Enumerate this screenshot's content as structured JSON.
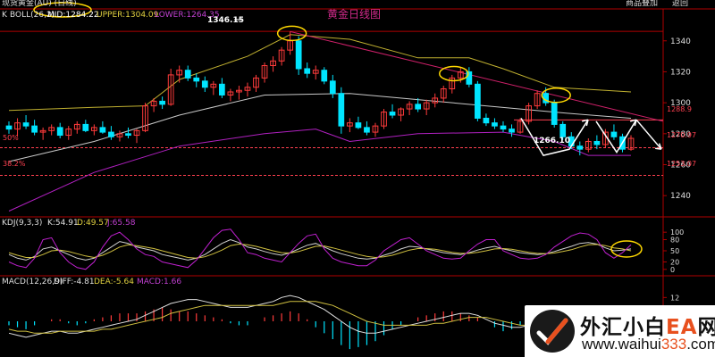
{
  "window": {
    "title": "现货黄金(AU) (日线)",
    "top_right": [
      "商品叠加",
      "返回"
    ]
  },
  "main_indicator": {
    "name": "K",
    "boll_label": "BOLL(26,2)",
    "mid_label": "MID:1284.22",
    "upper_label": "UPPER:1304.09",
    "lower_label": "LOWER:1264.35",
    "chart_title": "黄金日线图"
  },
  "kdj_header": {
    "name": "KDJ(9,3,3)",
    "k": "K:54.91",
    "d": "D:49.57",
    "j": "J:65.58"
  },
  "macd_header": {
    "name": "MACD(12,26,9)",
    "diff": "DIFF:-4.81",
    "dea": "DEA:-5.64",
    "macd": "MACD:1.66"
  },
  "annotations": {
    "high_label": "1346.15",
    "low_label": "1266.10",
    "pct50": "50%",
    "pct382": "38.2%",
    "level_upper": "1288.9",
    "level_mid": "1270.97",
    "level_lower": "1253.07"
  },
  "watermark": {
    "brand_a": "外汇小白",
    "brand_b": "EA",
    "brand_c": "网",
    "url_a": "www.waihui",
    "url_b": "333",
    "url_c": ".com"
  },
  "colors": {
    "up": "#ff3b3b",
    "down": "#00e5ff",
    "mid": "#c8c8c8",
    "upper": "#c0b030",
    "lower": "#b020c0",
    "trend": "#d0206a",
    "level": "#ff4050",
    "arrows": "#ffffff",
    "circle": "#ffd800",
    "kdj_k": "#d0d0d0",
    "kdj_d": "#d0c040",
    "kdj_j": "#c020d0"
  },
  "chart_data": [
    {
      "type": "candlestick",
      "title": "黄金日线图",
      "ylim": [
        1228,
        1356
      ],
      "yticks": [
        1240,
        1260,
        1280,
        1300,
        1320,
        1340
      ],
      "candles": [
        [
          1285,
          1288,
          1280,
          1283
        ],
        [
          1283,
          1290,
          1278,
          1287
        ],
        [
          1287,
          1292,
          1283,
          1285
        ],
        [
          1285,
          1289,
          1279,
          1281
        ],
        [
          1281,
          1284,
          1276,
          1282
        ],
        [
          1282,
          1286,
          1279,
          1284
        ],
        [
          1284,
          1287,
          1277,
          1279
        ],
        [
          1279,
          1285,
          1276,
          1283
        ],
        [
          1283,
          1288,
          1280,
          1286
        ],
        [
          1286,
          1289,
          1281,
          1282
        ],
        [
          1282,
          1286,
          1279,
          1284
        ],
        [
          1284,
          1288,
          1280,
          1281
        ],
        [
          1281,
          1285,
          1276,
          1278
        ],
        [
          1278,
          1282,
          1275,
          1280
        ],
        [
          1280,
          1284,
          1277,
          1279
        ],
        [
          1279,
          1283,
          1274,
          1282
        ],
        [
          1282,
          1300,
          1281,
          1298
        ],
        [
          1298,
          1303,
          1294,
          1301
        ],
        [
          1301,
          1304,
          1296,
          1299
        ],
        [
          1299,
          1322,
          1298,
          1318
        ],
        [
          1318,
          1324,
          1313,
          1321
        ],
        [
          1321,
          1324,
          1314,
          1316
        ],
        [
          1316,
          1319,
          1310,
          1314
        ],
        [
          1314,
          1317,
          1307,
          1310
        ],
        [
          1310,
          1314,
          1305,
          1312
        ],
        [
          1312,
          1316,
          1303,
          1305
        ],
        [
          1305,
          1309,
          1301,
          1307
        ],
        [
          1307,
          1311,
          1302,
          1308
        ],
        [
          1308,
          1313,
          1304,
          1310
        ],
        [
          1310,
          1318,
          1307,
          1316
        ],
        [
          1316,
          1326,
          1313,
          1324
        ],
        [
          1324,
          1330,
          1320,
          1327
        ],
        [
          1327,
          1336,
          1324,
          1334
        ],
        [
          1334,
          1346,
          1331,
          1340
        ],
        [
          1340,
          1343,
          1318,
          1322
        ],
        [
          1322,
          1326,
          1316,
          1319
        ],
        [
          1319,
          1324,
          1315,
          1321
        ],
        [
          1321,
          1323,
          1312,
          1314
        ],
        [
          1314,
          1318,
          1303,
          1306
        ],
        [
          1306,
          1310,
          1280,
          1285
        ],
        [
          1285,
          1290,
          1281,
          1287
        ],
        [
          1287,
          1291,
          1283,
          1284
        ],
        [
          1284,
          1288,
          1279,
          1281
        ],
        [
          1281,
          1287,
          1278,
          1285
        ],
        [
          1285,
          1296,
          1283,
          1294
        ],
        [
          1294,
          1299,
          1290,
          1292
        ],
        [
          1292,
          1297,
          1288,
          1296
        ],
        [
          1296,
          1301,
          1292,
          1299
        ],
        [
          1299,
          1303,
          1294,
          1296
        ],
        [
          1296,
          1302,
          1292,
          1300
        ],
        [
          1300,
          1306,
          1297,
          1303
        ],
        [
          1303,
          1311,
          1300,
          1309
        ],
        [
          1309,
          1318,
          1306,
          1316
        ],
        [
          1316,
          1323,
          1313,
          1320
        ],
        [
          1320,
          1323,
          1310,
          1312
        ],
        [
          1312,
          1314,
          1288,
          1290
        ],
        [
          1290,
          1293,
          1285,
          1287
        ],
        [
          1287,
          1290,
          1283,
          1285
        ],
        [
          1285,
          1288,
          1281,
          1283
        ],
        [
          1283,
          1286,
          1278,
          1281
        ],
        [
          1281,
          1290,
          1280,
          1288
        ],
        [
          1288,
          1300,
          1286,
          1298
        ],
        [
          1298,
          1308,
          1296,
          1306
        ],
        [
          1306,
          1310,
          1298,
          1300
        ],
        [
          1300,
          1302,
          1284,
          1286
        ],
        [
          1286,
          1288,
          1276,
          1278
        ],
        [
          1278,
          1281,
          1270,
          1272
        ],
        [
          1272,
          1275,
          1266,
          1270
        ],
        [
          1270,
          1277,
          1268,
          1275
        ],
        [
          1275,
          1279,
          1270,
          1273
        ],
        [
          1273,
          1283,
          1271,
          1281
        ],
        [
          1281,
          1286,
          1276,
          1278
        ],
        [
          1278,
          1280,
          1268,
          1270
        ],
        [
          1270,
          1279,
          1269,
          1277
        ]
      ],
      "boll": {
        "mid": [
          [
            0,
            1262
          ],
          [
            10,
            1275
          ],
          [
            20,
            1292
          ],
          [
            30,
            1305
          ],
          [
            40,
            1306
          ],
          [
            50,
            1301
          ],
          [
            60,
            1296
          ],
          [
            66,
            1293
          ],
          [
            73,
            1290
          ]
        ],
        "upper": [
          [
            0,
            1295
          ],
          [
            10,
            1297
          ],
          [
            16,
            1298
          ],
          [
            20,
            1315
          ],
          [
            28,
            1330
          ],
          [
            33,
            1344
          ],
          [
            40,
            1341
          ],
          [
            48,
            1329
          ],
          [
            54,
            1329
          ],
          [
            58,
            1322
          ],
          [
            64,
            1310
          ],
          [
            70,
            1308
          ],
          [
            73,
            1307
          ]
        ],
        "lower": [
          [
            0,
            1230
          ],
          [
            10,
            1255
          ],
          [
            20,
            1272
          ],
          [
            30,
            1280
          ],
          [
            36,
            1283
          ],
          [
            40,
            1275
          ],
          [
            48,
            1280
          ],
          [
            58,
            1281
          ],
          [
            64,
            1275
          ],
          [
            68,
            1266
          ],
          [
            73,
            1266
          ]
        ]
      },
      "levels": [
        1288.9,
        1270.97,
        1253.07
      ]
    },
    {
      "type": "line",
      "name": "KDJ(9,3,3)",
      "ylim": [
        -10,
        110
      ],
      "yticks": [
        0,
        20,
        50,
        80,
        100
      ],
      "series": [
        {
          "name": "K",
          "values": [
            40,
            30,
            25,
            35,
            55,
            60,
            50,
            40,
            30,
            25,
            30,
            45,
            60,
            75,
            70,
            60,
            55,
            50,
            40,
            35,
            30,
            25,
            30,
            40,
            55,
            70,
            80,
            72,
            60,
            55,
            48,
            42,
            38,
            45,
            55,
            65,
            70,
            60,
            50,
            42,
            36,
            30,
            28,
            30,
            38,
            45,
            55,
            62,
            60,
            55,
            50,
            45,
            42,
            40,
            45,
            52,
            58,
            62,
            55,
            50,
            45,
            42,
            40,
            42,
            48,
            55,
            62,
            70,
            72,
            68,
            58,
            50,
            52,
            55
          ]
        },
        {
          "name": "D",
          "values": [
            45,
            38,
            32,
            32,
            40,
            50,
            52,
            48,
            42,
            36,
            32,
            38,
            48,
            60,
            66,
            64,
            60,
            56,
            50,
            44,
            38,
            32,
            30,
            34,
            42,
            52,
            64,
            68,
            66,
            62,
            56,
            50,
            45,
            44,
            48,
            55,
            62,
            63,
            58,
            52,
            46,
            40,
            35,
            32,
            34,
            38,
            45,
            52,
            56,
            56,
            54,
            50,
            46,
            43,
            43,
            46,
            50,
            55,
            56,
            54,
            50,
            46,
            43,
            42,
            44,
            48,
            53,
            60,
            66,
            67,
            64,
            58,
            55,
            50
          ]
        },
        {
          "name": "J",
          "values": [
            20,
            10,
            5,
            30,
            80,
            85,
            45,
            20,
            5,
            0,
            20,
            60,
            90,
            100,
            80,
            55,
            40,
            35,
            20,
            15,
            10,
            5,
            25,
            55,
            85,
            105,
            108,
            80,
            45,
            40,
            30,
            25,
            20,
            45,
            70,
            90,
            95,
            55,
            30,
            20,
            15,
            10,
            10,
            25,
            50,
            65,
            80,
            85,
            68,
            50,
            40,
            30,
            28,
            30,
            50,
            68,
            80,
            80,
            50,
            40,
            30,
            28,
            30,
            40,
            60,
            75,
            90,
            98,
            95,
            80,
            45,
            30,
            45,
            66
          ]
        }
      ]
    },
    {
      "type": "bar",
      "name": "MACD(12,26,9)",
      "ylim": [
        -18,
        18
      ],
      "yticks": [
        0,
        12
      ],
      "series": [
        {
          "name": "DIFF",
          "values": [
            -6,
            -7,
            -8,
            -7,
            -6,
            -5,
            -5,
            -6,
            -6,
            -5,
            -4,
            -3,
            -2,
            -1,
            0,
            1,
            3,
            5,
            7,
            9,
            10,
            11,
            11,
            10,
            9,
            8,
            7,
            7,
            7,
            8,
            9,
            10,
            12,
            13,
            12,
            10,
            8,
            6,
            3,
            0,
            -3,
            -5,
            -6,
            -6,
            -5,
            -4,
            -3,
            -2,
            -1,
            0,
            1,
            2,
            3,
            4,
            4,
            3,
            1,
            -1,
            -2,
            -3,
            -3,
            -2,
            -1,
            0,
            -1,
            -2,
            -4,
            -5,
            -6,
            -6,
            -5,
            -5,
            -5,
            -5
          ]
        },
        {
          "name": "DEA",
          "values": [
            -4,
            -5,
            -5,
            -6,
            -6,
            -6,
            -5,
            -5,
            -5,
            -5,
            -5,
            -4,
            -4,
            -3,
            -2,
            -1,
            0,
            1,
            2,
            4,
            5,
            6,
            7,
            8,
            8,
            8,
            8,
            8,
            8,
            8,
            8,
            8,
            9,
            10,
            10,
            10,
            10,
            9,
            8,
            6,
            4,
            2,
            0,
            -1,
            -2,
            -2,
            -2,
            -2,
            -2,
            -2,
            -1,
            -1,
            0,
            1,
            2,
            2,
            2,
            1,
            0,
            -1,
            -2,
            -2,
            -2,
            -2,
            -2,
            -2,
            -2,
            -3,
            -4,
            -5,
            -5,
            -5,
            -5,
            -5
          ]
        },
        {
          "name": "MACD",
          "values": [
            -2,
            -3,
            -4,
            -2,
            0,
            1,
            1,
            -1,
            -2,
            -1,
            1,
            2,
            3,
            4,
            4,
            4,
            5,
            6,
            7,
            6,
            5,
            5,
            4,
            3,
            2,
            1,
            -1,
            -2,
            -2,
            0,
            2,
            3,
            4,
            5,
            4,
            1,
            -3,
            -6,
            -9,
            -12,
            -14,
            -13,
            -12,
            -10,
            -7,
            -4,
            -2,
            0,
            2,
            3,
            4,
            5,
            5,
            4,
            3,
            2,
            0,
            -3,
            -5,
            -4,
            -2,
            0,
            2,
            3,
            2,
            0,
            -3,
            -4,
            -4,
            -2,
            0,
            0,
            1,
            2
          ]
        }
      ]
    }
  ]
}
